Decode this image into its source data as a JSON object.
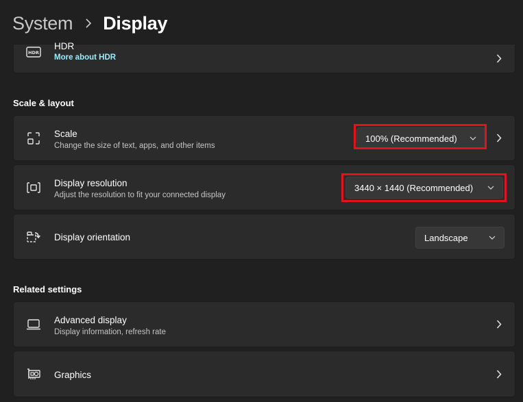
{
  "breadcrumb": {
    "parent": "System",
    "current": "Display"
  },
  "hdr": {
    "title": "HDR",
    "link": "More about HDR"
  },
  "sections": {
    "scale_layout": "Scale & layout",
    "related": "Related settings"
  },
  "scale": {
    "title": "Scale",
    "subtitle": "Change the size of text, apps, and other items",
    "value": "100% (Recommended)"
  },
  "resolution": {
    "title": "Display resolution",
    "subtitle": "Adjust the resolution to fit your connected display",
    "value": "3440 × 1440 (Recommended)"
  },
  "orientation": {
    "title": "Display orientation",
    "value": "Landscape"
  },
  "advanced": {
    "title": "Advanced display",
    "subtitle": "Display information, refresh rate"
  },
  "graphics": {
    "title": "Graphics"
  },
  "colors": {
    "background": "#202020",
    "card": "#2b2b2b",
    "accent_link": "#99ebff",
    "highlight": "#e0141e"
  },
  "icons": [
    "chevron-right-icon",
    "hdr-icon",
    "scale-icon",
    "resolution-icon",
    "orientation-icon",
    "monitor-icon",
    "graphics-card-icon",
    "chevron-down-icon"
  ]
}
